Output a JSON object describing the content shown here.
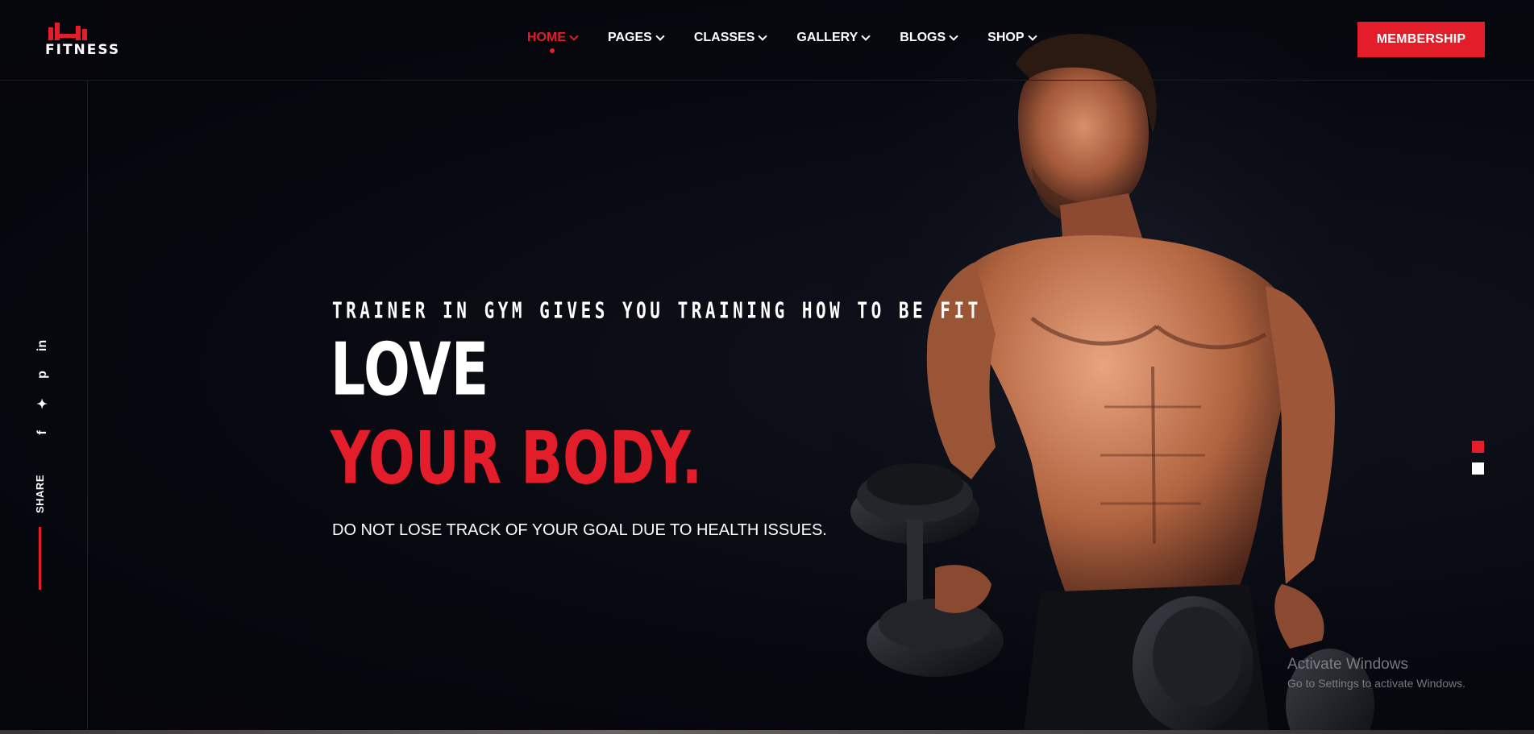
{
  "brand": {
    "logo_text": "FITNESS",
    "accent_color": "#e31e2a"
  },
  "nav": {
    "items": [
      {
        "label": "HOME",
        "active": true
      },
      {
        "label": "PAGES",
        "active": false
      },
      {
        "label": "CLASSES",
        "active": false
      },
      {
        "label": "GALLERY",
        "active": false
      },
      {
        "label": "BLOGS",
        "active": false
      },
      {
        "label": "SHOP",
        "active": false
      }
    ],
    "cta_label": "MEMBERSHIP"
  },
  "sidebar": {
    "social_icons": [
      {
        "name": "linkedin-icon",
        "glyph": "in"
      },
      {
        "name": "pinterest-icon",
        "glyph": "p"
      },
      {
        "name": "twitter-icon",
        "glyph": "✦"
      },
      {
        "name": "facebook-icon",
        "glyph": "f"
      }
    ],
    "share_label": "SHARE"
  },
  "hero": {
    "eyebrow": "TRAINER IN GYM GIVES YOU TRAINING HOW TO BE FIT",
    "headline_line1": "LOVE",
    "headline_line2": "YOUR BODY.",
    "subtext": "DO NOT LOSE TRACK OF YOUR GOAL DUE TO HEALTH ISSUES."
  },
  "slider": {
    "slide_count": 2,
    "active_index": 0
  },
  "watermark": {
    "title": "Activate Windows",
    "subtitle": "Go to Settings to activate Windows."
  }
}
